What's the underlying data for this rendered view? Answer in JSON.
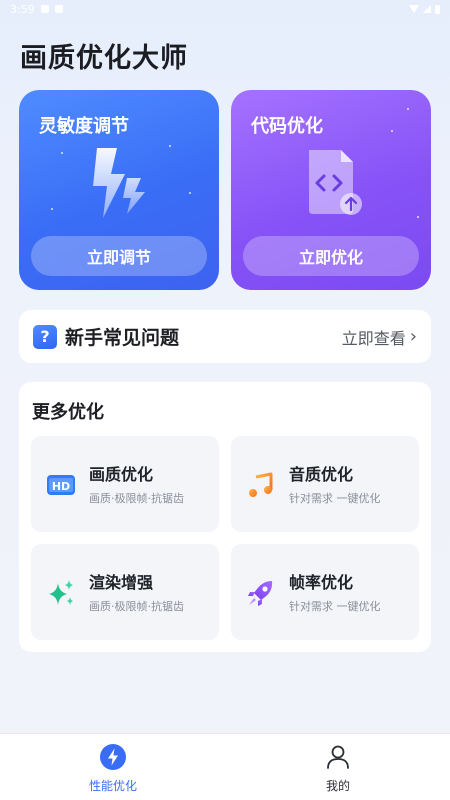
{
  "status_bar": {
    "time": "3:59"
  },
  "app": {
    "title": "画质优化大师"
  },
  "hero_cards": [
    {
      "title": "灵敏度调节",
      "button": "立即调节",
      "icon": "lightning-icon",
      "color_start": "#4f8cff",
      "color_end": "#3d63f0"
    },
    {
      "title": "代码优化",
      "button": "立即优化",
      "icon": "code-file-icon",
      "color_start": "#a572ff",
      "color_end": "#7c4af2"
    }
  ],
  "faq": {
    "title": "新手常见问题",
    "link": "立即查看",
    "icon": "question-icon"
  },
  "more": {
    "title": "更多优化",
    "items": [
      {
        "title": "画质优化",
        "subtitle": "画质·极限帧·抗锯齿",
        "icon": "hd-icon"
      },
      {
        "title": "音质优化",
        "subtitle": "针对需求 一键优化",
        "icon": "music-note-icon"
      },
      {
        "title": "渲染增强",
        "subtitle": "画质·极限帧·抗锯齿",
        "icon": "sparkle-icon"
      },
      {
        "title": "帧率优化",
        "subtitle": "针对需求 一键优化",
        "icon": "rocket-icon"
      }
    ]
  },
  "tabbar": {
    "tabs": [
      {
        "label": "性能优化",
        "icon": "lightning-tab-icon",
        "active": true
      },
      {
        "label": "我的",
        "icon": "user-icon",
        "active": false
      }
    ],
    "active_color": "#3a6df6"
  }
}
